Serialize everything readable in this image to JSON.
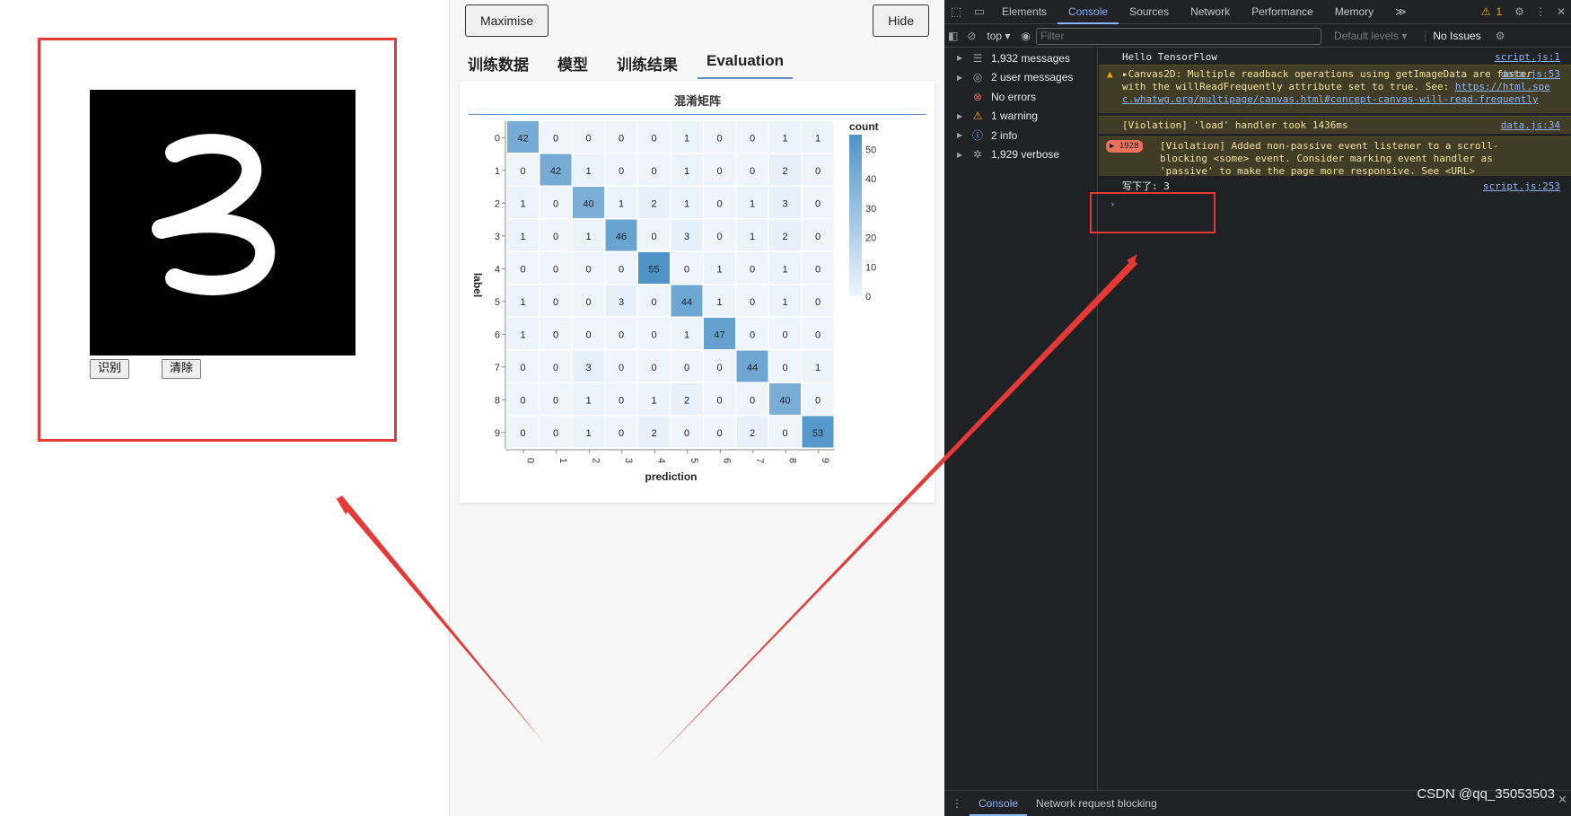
{
  "drawing": {
    "recognize_label": "识别",
    "clear_label": "清除",
    "digit": "3"
  },
  "visor": {
    "maximise_label": "Maximise",
    "hide_label": "Hide",
    "tabs": [
      {
        "label": "训练数据"
      },
      {
        "label": "模型"
      },
      {
        "label": "训练结果"
      },
      {
        "label": "Evaluation"
      }
    ],
    "active_tab": "Evaluation",
    "chart_title": "混淆矩阵"
  },
  "chart_data": {
    "type": "heatmap",
    "title": "混淆矩阵",
    "xlabel": "prediction",
    "ylabel": "label",
    "legend_title": "count",
    "legend_ticks": [
      50,
      40,
      30,
      20,
      10,
      0
    ],
    "legend_range": [
      0,
      55
    ],
    "x_categories": [
      "0",
      "1",
      "2",
      "3",
      "4",
      "5",
      "6",
      "7",
      "8",
      "9"
    ],
    "y_categories": [
      "0",
      "1",
      "2",
      "3",
      "4",
      "5",
      "6",
      "7",
      "8",
      "9"
    ],
    "values": [
      [
        42,
        0,
        0,
        0,
        0,
        1,
        0,
        0,
        1,
        1
      ],
      [
        0,
        42,
        1,
        0,
        0,
        1,
        0,
        0,
        2,
        0
      ],
      [
        1,
        0,
        40,
        1,
        2,
        1,
        0,
        1,
        3,
        0
      ],
      [
        1,
        0,
        1,
        46,
        0,
        3,
        0,
        1,
        2,
        0
      ],
      [
        0,
        0,
        0,
        0,
        55,
        0,
        1,
        0,
        1,
        0
      ],
      [
        1,
        0,
        0,
        3,
        0,
        44,
        1,
        0,
        1,
        0
      ],
      [
        1,
        0,
        0,
        0,
        0,
        1,
        47,
        0,
        0,
        0
      ],
      [
        0,
        0,
        3,
        0,
        0,
        0,
        0,
        44,
        0,
        1
      ],
      [
        0,
        0,
        1,
        0,
        1,
        2,
        0,
        0,
        40,
        0
      ],
      [
        0,
        0,
        1,
        0,
        2,
        0,
        0,
        2,
        0,
        53
      ]
    ],
    "colors": {
      "low": "#eef5fc",
      "high": "#4f94c9"
    }
  },
  "devtools": {
    "tabs": [
      "Elements",
      "Console",
      "Sources",
      "Network",
      "Performance",
      "Memory"
    ],
    "active_tab": "Console",
    "more_tabs": "≫",
    "warning_count": "1",
    "context": "top",
    "filter_placeholder": "Filter",
    "levels_label": "Default levels",
    "issues_label": "No Issues",
    "sidebar": [
      {
        "label": "1,932 messages",
        "icon": "list-icon",
        "glyph": "☰",
        "arrow": true
      },
      {
        "label": "2 user messages",
        "icon": "user-icon",
        "glyph": "◎",
        "arrow": true
      },
      {
        "label": "No errors",
        "icon": "error-icon",
        "glyph": "⊗",
        "arrow": false
      },
      {
        "label": "1 warning",
        "icon": "warning-icon",
        "glyph": "⚠",
        "arrow": true
      },
      {
        "label": "2 info",
        "icon": "info-icon",
        "glyph": "ⓘ",
        "arrow": true
      },
      {
        "label": "1,929 verbose",
        "icon": "bug-icon",
        "glyph": "✲",
        "arrow": true
      }
    ],
    "messages": {
      "hello_text": "Hello TensorFlow",
      "hello_src": "script.js:1",
      "canvas_prefix": "▸Canvas2D: Multiple readback operations using getImageData are faster with the willReadFrequently attribute set to true. See: ",
      "canvas_link": "https://html.spec.whatwg.org/multipage/canvas.html#concept-canvas-will-read-frequently",
      "canvas_src": "data.js:53",
      "load_text": "[Violation] 'load' handler took 1436ms",
      "load_src": "data.js:34",
      "badge": "▶ 1928",
      "passive_text": "[Violation] Added non-passive event listener to a scroll-blocking <some> event. Consider marking event handler as 'passive' to make the page more responsive. See <URL>",
      "write_text": "写下了: 3",
      "write_src": "script.js:253",
      "prompt": "›"
    },
    "bottom_tabs": [
      "Console",
      "Network request blocking"
    ],
    "watermark": "CSDN @qq_35053503",
    "close": "✕"
  },
  "annotation_color": "#e53935"
}
